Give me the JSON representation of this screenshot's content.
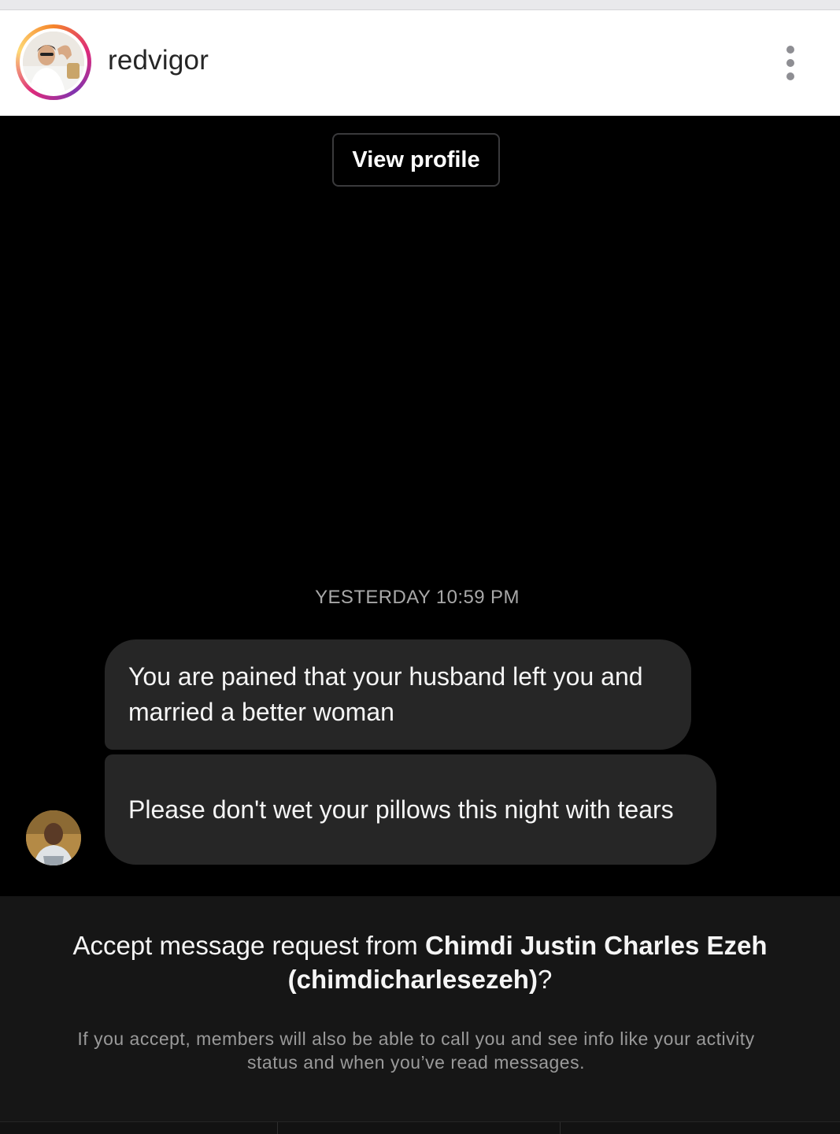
{
  "header": {
    "username": "redvigor",
    "avatar_icon": "profile-avatar",
    "more_icon": "more-vertical-icon"
  },
  "conversation": {
    "view_profile_label": "View profile",
    "timestamp": "YESTERDAY 10:59 PM",
    "messages": [
      {
        "text": "You are pained that your husband left you and married a better woman"
      },
      {
        "text": "Please don't wet your pillows this night with tears"
      }
    ]
  },
  "request": {
    "title_prefix": "Accept message request from ",
    "sender_name": "Chimdi Justin Charles Ezeh",
    "sender_handle": "(chimdicharlesezeh)",
    "title_suffix": "?",
    "subtitle": "If you accept, members will also be able to call you and see info like your activity status and when you’ve read messages."
  },
  "colors": {
    "background": "#000000",
    "bubble": "#262626",
    "panel": "#161616",
    "ring_gradient": [
      "#f58529",
      "#dd2a7b",
      "#8134af"
    ]
  }
}
